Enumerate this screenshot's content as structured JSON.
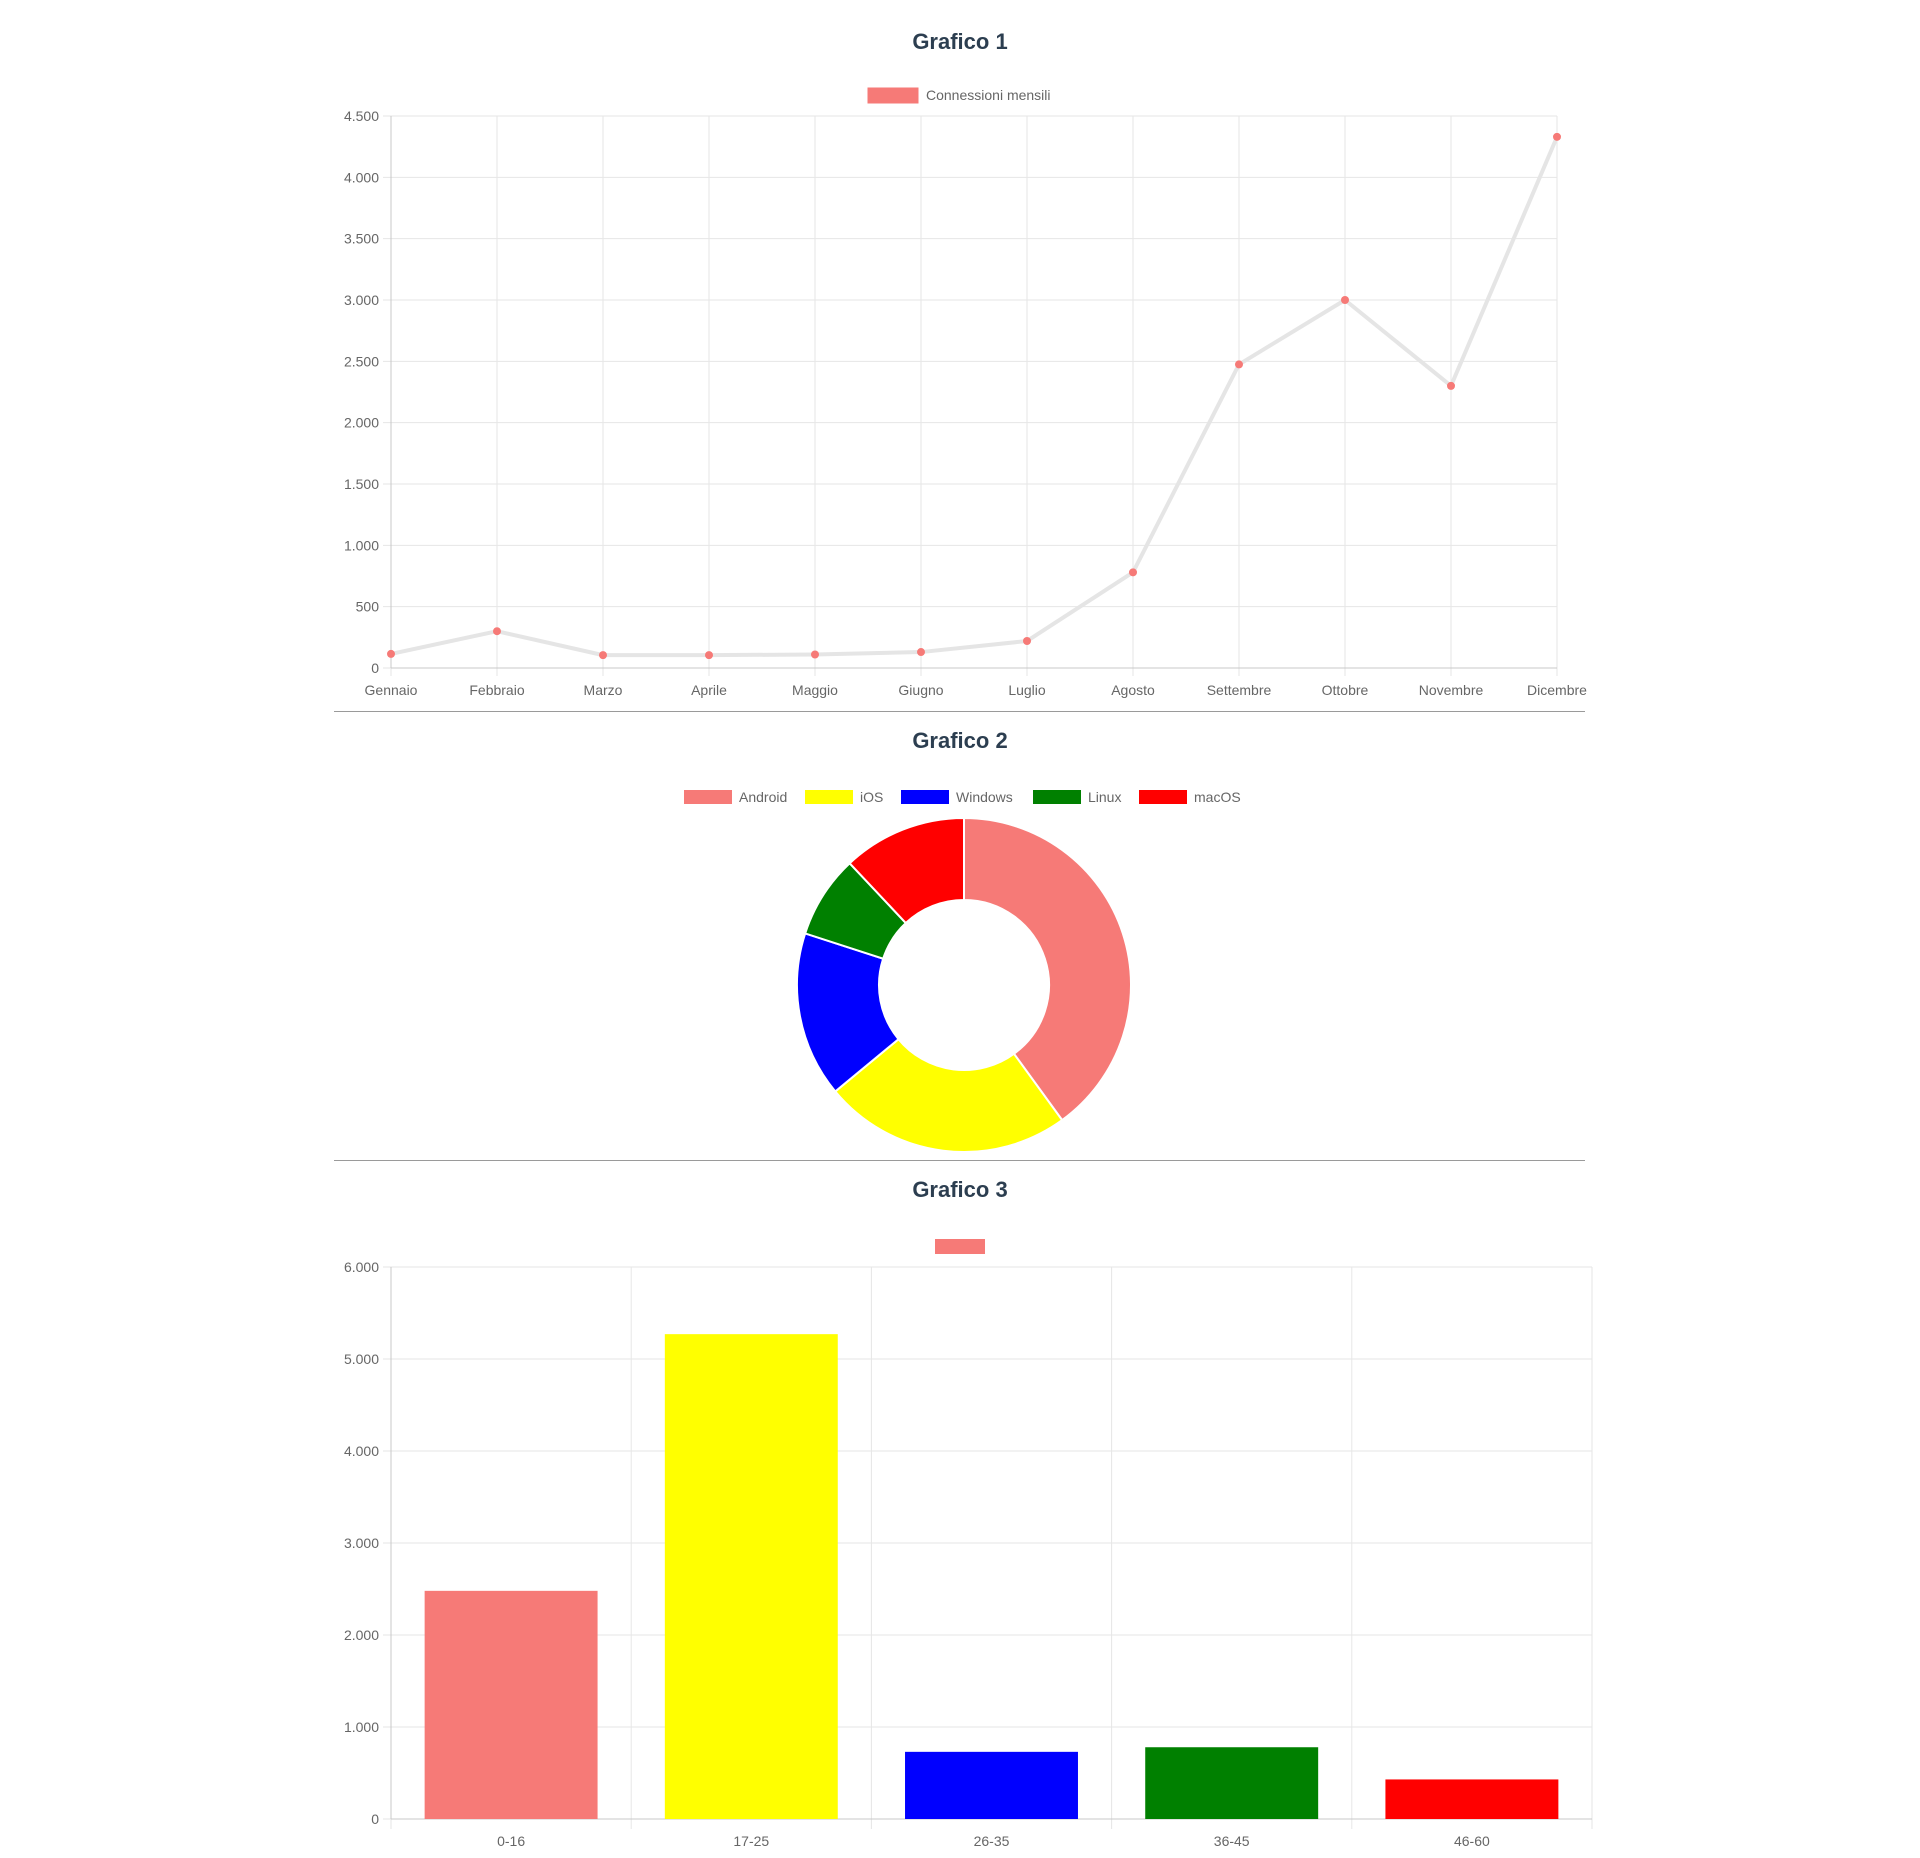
{
  "charts": [
    {
      "heading": "Grafico 1",
      "chart_data": {
        "type": "line",
        "categories": [
          "Gennaio",
          "Febbraio",
          "Marzo",
          "Aprile",
          "Maggio",
          "Giugno",
          "Luglio",
          "Agosto",
          "Settembre",
          "Ottobre",
          "Novembre",
          "Dicembre"
        ],
        "series": [
          {
            "name": "Connessioni mensili",
            "values": [
              115,
              300,
              105,
              105,
              110,
              130,
              220,
              780,
              2475,
              3000,
              2300,
              4330
            ],
            "line_color": "#e5e5e5",
            "point_color": "#f67a77",
            "legend_color": "#f67a77"
          }
        ],
        "ylim": [
          0,
          4500
        ],
        "yticks": [
          0,
          500,
          1000,
          1500,
          2000,
          2500,
          3000,
          3500,
          4000,
          4500
        ],
        "ytick_labels": [
          "0",
          "500",
          "1.000",
          "1.500",
          "2.000",
          "2.500",
          "3.000",
          "3.500",
          "4.000",
          "4.500"
        ],
        "grid": true,
        "legend": "top"
      }
    },
    {
      "heading": "Grafico 2",
      "chart_data": {
        "type": "pie",
        "variant": "doughnut",
        "labels": [
          "Android",
          "iOS",
          "Windows",
          "Linux",
          "macOS"
        ],
        "values": [
          40,
          24,
          16,
          8,
          12
        ],
        "colors": [
          "#f67a77",
          "#ffff00",
          "#0000ff",
          "#008000",
          "#ff0000"
        ],
        "legend": "top"
      }
    },
    {
      "heading": "Grafico 3",
      "chart_data": {
        "type": "bar",
        "categories": [
          "0-16",
          "17-25",
          "26-35",
          "36-45",
          "46-60"
        ],
        "values": [
          2480,
          5270,
          730,
          780,
          430
        ],
        "colors": [
          "#f67a77",
          "#ffff00",
          "#0000ff",
          "#008000",
          "#ff0000"
        ],
        "legend_swatch_color": "#f67a77",
        "ylim": [
          0,
          6000
        ],
        "yticks": [
          0,
          1000,
          2000,
          3000,
          4000,
          5000,
          6000
        ],
        "ytick_labels": [
          "0",
          "1.000",
          "2.000",
          "3.000",
          "4.000",
          "5.000",
          "6.000"
        ],
        "grid": true,
        "legend": "top"
      }
    }
  ]
}
